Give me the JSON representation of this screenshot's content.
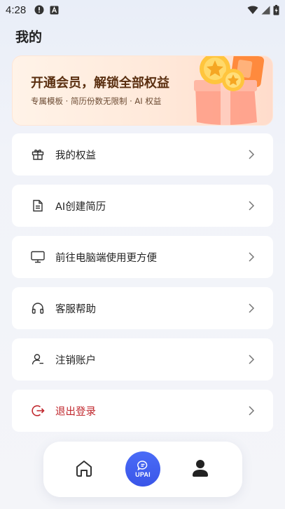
{
  "status_bar": {
    "time": "4:28",
    "left_icons": [
      "alert-circle-icon",
      "font-a-icon"
    ],
    "right_icons": [
      "wifi-icon",
      "signal-icon",
      "battery-icon"
    ]
  },
  "page_title": "我的",
  "vip_banner": {
    "title": "开通会员，解锁全部权益",
    "subtitle": "专属模板 · 简历份数无限制 · AI 权益"
  },
  "menu": [
    {
      "icon": "gift-icon",
      "label": "我的权益"
    },
    {
      "icon": "document-icon",
      "label": "AI创建简历"
    },
    {
      "icon": "monitor-icon",
      "label": "前往电脑端使用更方便"
    },
    {
      "icon": "headset-icon",
      "label": "客服帮助"
    },
    {
      "icon": "user-remove-icon",
      "label": "注销账户"
    },
    {
      "icon": "logout-icon",
      "label": "退出登录"
    }
  ],
  "bottom_nav": {
    "center_label": "UPAI",
    "items": [
      "home-icon",
      "chat-icon",
      "profile-icon"
    ]
  },
  "colors": {
    "danger": "#c0272d",
    "accent": "#3a55e8"
  }
}
